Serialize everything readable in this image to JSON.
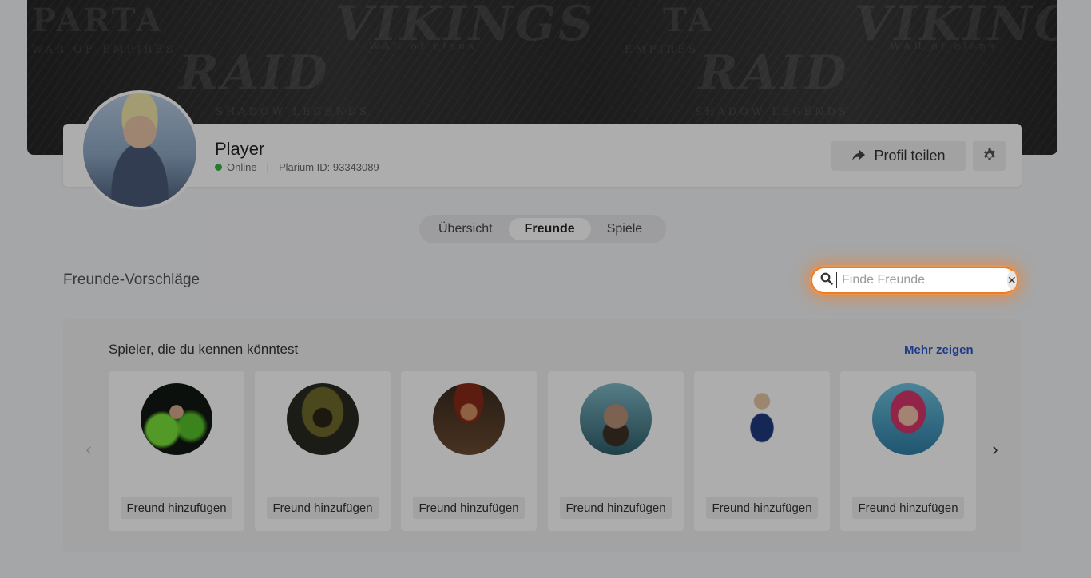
{
  "banner": {
    "words": [
      "PARTA",
      "VIKINGS",
      "WAR OF EMPIRES",
      "WAR of clans",
      "RAID",
      "SHADOW LEGENDS",
      "TA",
      "VIKINGSS",
      "EMPIRES",
      "WAR of clans",
      "RAID",
      "SHADOW LEGENDS"
    ]
  },
  "profile": {
    "name": "Player",
    "status": "Online",
    "separator": "|",
    "id_text": "Plarium ID: 93343089",
    "share_label": "Profil teilen"
  },
  "tabs": [
    {
      "label": "Übersicht",
      "active": false
    },
    {
      "label": "Freunde",
      "active": true
    },
    {
      "label": "Spiele",
      "active": false
    }
  ],
  "section": {
    "title": "Freunde-Vorschläge"
  },
  "search": {
    "placeholder": "Finde Freunde",
    "value": ""
  },
  "suggestions": {
    "heading": "Spieler, die du kennen könntest",
    "more_label": "Mehr zeigen",
    "cards": [
      {
        "button": "Freund hinzufügen"
      },
      {
        "button": "Freund hinzufügen"
      },
      {
        "button": "Freund hinzufügen"
      },
      {
        "button": "Freund hinzufügen"
      },
      {
        "button": "Freund hinzufügen"
      },
      {
        "button": "Freund hinzufügen"
      }
    ]
  },
  "icons": {
    "share": "share-arrow-icon",
    "settings": "gear-icon",
    "search": "search-icon",
    "clear": "close-icon",
    "prev": "chevron-left-icon",
    "next": "chevron-right-icon"
  },
  "colors": {
    "accent_orange": "#f37a1f",
    "link_blue": "#2f57c9",
    "online_green": "#39b54a"
  }
}
